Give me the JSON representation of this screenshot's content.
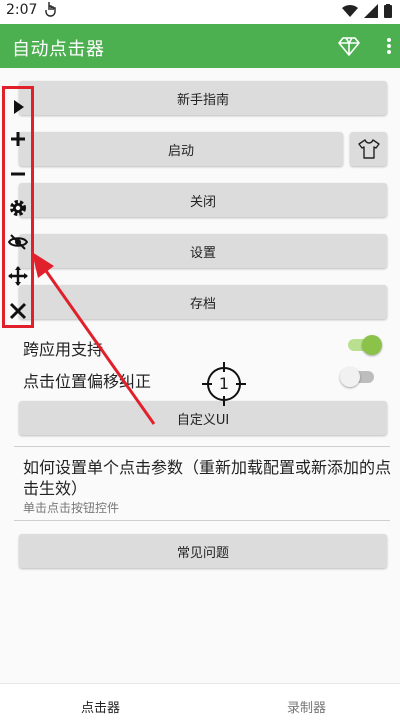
{
  "status_bar": {
    "time": "2:07"
  },
  "app_bar": {
    "title": "自动点击器"
  },
  "buttons": {
    "guide": "新手指南",
    "start": "启动",
    "close": "关闭",
    "settings": "设置",
    "save": "存档",
    "custom_ui": "自定义UI",
    "faq": "常见问题"
  },
  "toggles": {
    "cross_app": {
      "label": "跨应用支持",
      "on": true
    },
    "offset_fix": {
      "label": "点击位置偏移纠正",
      "on": false
    }
  },
  "info": {
    "title": "如何设置单个点击参数（重新加载配置或新添加的点击生效）",
    "subtitle": "单击点击按钮控件"
  },
  "target": {
    "number": "1"
  },
  "bottom_nav": {
    "tabs": [
      "点击器",
      "录制器"
    ]
  },
  "colors": {
    "primary": "#4caf50",
    "toggle_on": "#8bc34a",
    "highlight": "#e0202a"
  }
}
